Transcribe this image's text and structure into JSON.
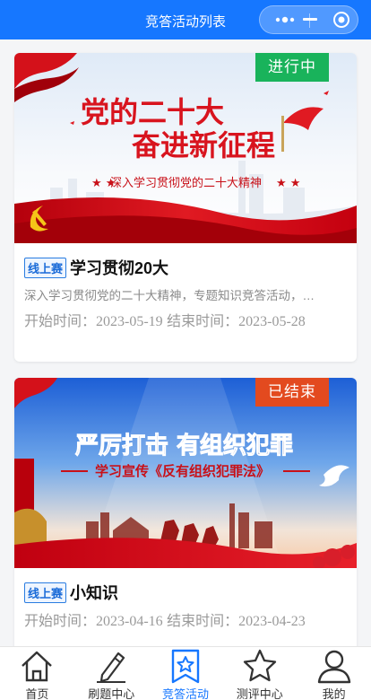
{
  "navbar": {
    "title": "竞答活动列表",
    "more_icon": "more-dots-icon",
    "minimize_icon": "minimize-icon",
    "close_icon": "record-circle-icon"
  },
  "activities": [
    {
      "status": "进行中",
      "status_color": "#19b35b",
      "banner": {
        "headline_1": "党的二十大",
        "headline_2": "奋进新征程",
        "subline": "深入学习贯彻党的二十大精神"
      },
      "tag": "线上赛",
      "title": "学习贯彻20大",
      "description": "深入学习贯彻党的二十大精神，专题知识竞答活动，…",
      "start_label": "开始时间：",
      "start": "2023-05-19",
      "end_label": "结束时间：",
      "end": "2023-05-28"
    },
    {
      "status": "已结束",
      "status_color": "#e34a1f",
      "banner": {
        "headline": "严厉打击 有组织犯罪",
        "subline": "学习宣传《反有组织犯罪法》"
      },
      "tag": "线上赛",
      "title": "小知识",
      "start_label": "开始时间：",
      "start": "2023-04-16",
      "end_label": "结束时间：",
      "end": "2023-04-23"
    }
  ],
  "tabbar": {
    "active_color": "#1677ff",
    "items": [
      {
        "label": "首页",
        "icon": "home-icon"
      },
      {
        "label": "刷题中心",
        "icon": "pencil-icon"
      },
      {
        "label": "竞答活动",
        "icon": "star-badge-icon",
        "active": true
      },
      {
        "label": "测评中心",
        "icon": "star-icon"
      },
      {
        "label": "我的",
        "icon": "user-icon"
      }
    ]
  }
}
